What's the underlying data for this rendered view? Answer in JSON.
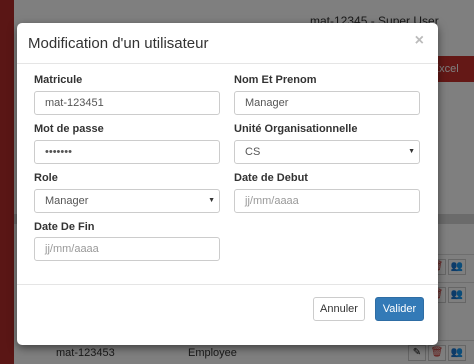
{
  "background": {
    "user_info": "mat-12345 - Super User",
    "export_label": "rt Excel",
    "rows": [
      {
        "matricule": "",
        "role": ""
      },
      {
        "matricule": "",
        "role": ""
      },
      {
        "matricule": "mat-123453",
        "role": "Employee"
      }
    ],
    "action_icons": [
      "edit-icon",
      "delete-icon",
      "users-icon"
    ]
  },
  "modal": {
    "title": "Modification d'un utilisateur",
    "close_symbol": "×",
    "fields": {
      "matricule": {
        "label": "Matricule",
        "value": "mat-123451"
      },
      "nom_prenom": {
        "label": "Nom Et Prenom",
        "value": "Manager"
      },
      "mot_de_passe": {
        "label": "Mot de passe",
        "value": "•••••••"
      },
      "unite": {
        "label": "Unité Organisationnelle",
        "value": "CS"
      },
      "role": {
        "label": "Role",
        "value": "Manager"
      },
      "date_debut": {
        "label": "Date de Debut",
        "placeholder": "jj/mm/aaaa"
      },
      "date_fin": {
        "label": "Date De Fin",
        "placeholder": "jj/mm/aaaa"
      }
    },
    "buttons": {
      "cancel": "Annuler",
      "submit": "Valider"
    }
  },
  "colors": {
    "primary": "#337ab7",
    "danger": "#c9302c",
    "overlay": "rgba(0,0,0,0.5)"
  }
}
